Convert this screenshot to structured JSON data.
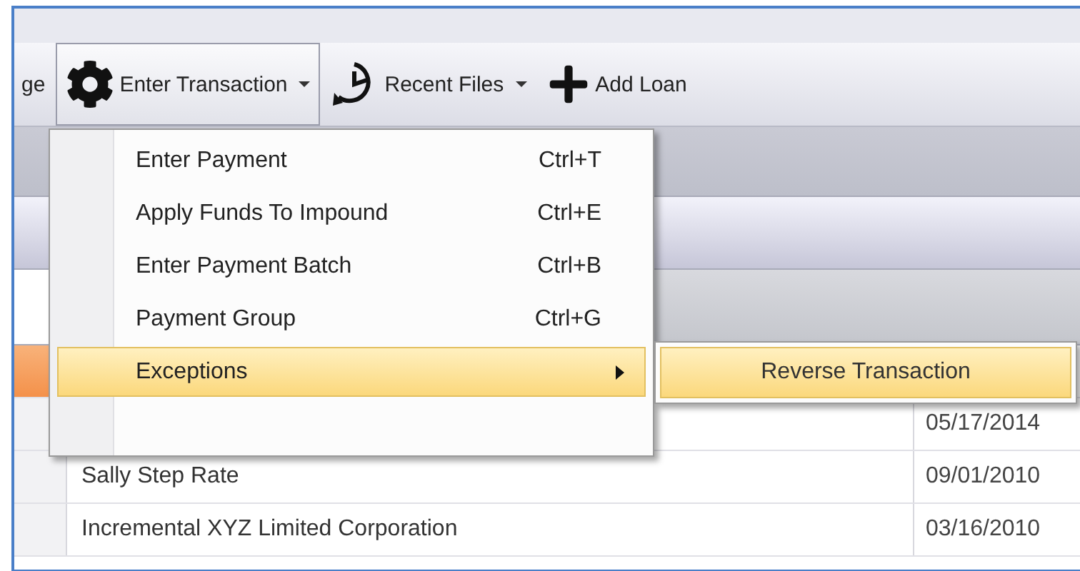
{
  "toolbar": {
    "buttons": [
      {
        "label": "ge",
        "kind": "cut",
        "dropdown": false,
        "selected": false
      },
      {
        "label": "Enter Transaction",
        "kind": "gear",
        "dropdown": true,
        "selected": true
      },
      {
        "label": "Recent Files",
        "kind": "clock",
        "dropdown": true,
        "selected": false
      },
      {
        "label": "Add Loan",
        "kind": "plus",
        "dropdown": false,
        "selected": false
      }
    ]
  },
  "menu": {
    "items": [
      {
        "label": "Enter Payment",
        "shortcut": "Ctrl+T",
        "selected": false,
        "submenu": false
      },
      {
        "label": "Apply Funds To Impound",
        "shortcut": "Ctrl+E",
        "selected": false,
        "submenu": false
      },
      {
        "label": "Enter Payment Batch",
        "shortcut": "Ctrl+B",
        "selected": false,
        "submenu": false
      },
      {
        "label": "Payment Group",
        "shortcut": "Ctrl+G",
        "selected": false,
        "submenu": false
      },
      {
        "label": "Exceptions",
        "selected": true,
        "submenu": true
      }
    ]
  },
  "submenu": {
    "items": [
      {
        "label": "Reverse Transaction",
        "selected": true
      }
    ]
  },
  "grid": {
    "rows": [
      {
        "selected": true
      },
      {
        "date": "05/17/2014",
        "selected": false
      },
      {
        "name": "Sally Step Rate",
        "date": "09/01/2010",
        "selected": false
      },
      {
        "name": "Incremental XYZ Limited Corporation",
        "date": "03/16/2010",
        "selected": false
      }
    ]
  }
}
